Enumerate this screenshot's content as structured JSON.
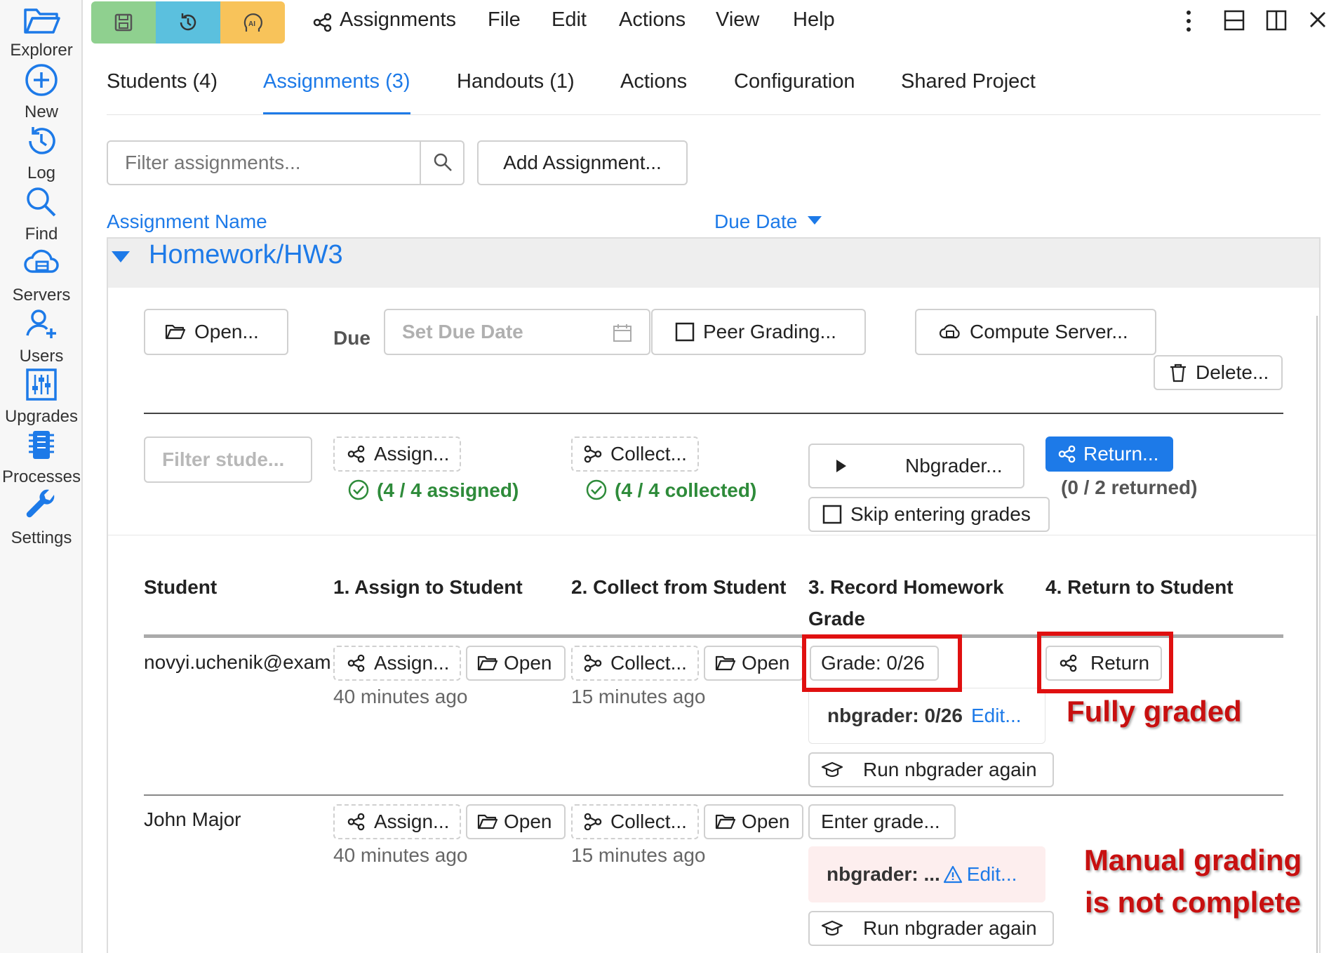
{
  "sidebar": {
    "items": [
      {
        "label": "Explorer",
        "icon": "folder-open-icon"
      },
      {
        "label": "New",
        "icon": "plus-circle-icon"
      },
      {
        "label": "Log",
        "icon": "history-icon"
      },
      {
        "label": "Find",
        "icon": "search-icon"
      },
      {
        "label": "Servers",
        "icon": "cloud-server-icon"
      },
      {
        "label": "Users",
        "icon": "users-icon"
      },
      {
        "label": "Upgrades",
        "icon": "sliders-icon"
      },
      {
        "label": "Processes",
        "icon": "chip-icon"
      },
      {
        "label": "Settings",
        "icon": "wrench-icon"
      }
    ]
  },
  "topbar": {
    "title": "Assignments",
    "menu": [
      "File",
      "Edit",
      "Actions",
      "View",
      "Help"
    ],
    "colors": {
      "save": "#8fd08f",
      "history": "#5bc0de",
      "ai": "#f8c35a"
    }
  },
  "tabs": [
    {
      "label": "Students (4)",
      "active": false
    },
    {
      "label": "Assignments (3)",
      "active": true
    },
    {
      "label": "Handouts (1)",
      "active": false
    },
    {
      "label": "Actions",
      "active": false
    },
    {
      "label": "Configuration",
      "active": false
    },
    {
      "label": "Shared Project",
      "active": false
    }
  ],
  "toolbar": {
    "filter_placeholder": "Filter assignments...",
    "add_label": "Add Assignment..."
  },
  "columns": {
    "name": "Assignment Name",
    "due": "Due Date"
  },
  "assignment": {
    "name": "Homework/HW3",
    "open_label": "Open...",
    "due_label": "Due",
    "due_placeholder": "Set Due Date",
    "peer_label": "Peer Grading...",
    "compute_label": "Compute Server...",
    "delete_label": "Delete...",
    "filter_students_placeholder": "Filter stude...",
    "assign_all_label": "Assign...",
    "assigned_status": "(4 / 4 assigned)",
    "collect_all_label": "Collect...",
    "collected_status": "(4 / 4 collected)",
    "nbgrader_label": "Nbgrader...",
    "skip_label": "Skip entering grades",
    "return_all_label": "Return...",
    "returned_status": "(0 / 2 returned)"
  },
  "student_table": {
    "headers": [
      "Student",
      "1. Assign to Student",
      "2. Collect from Student",
      "3. Record Homework",
      "Grade",
      "4. Return to Student"
    ],
    "rows": [
      {
        "student": "novyi.uchenik@exam",
        "assign_label": "Assign...",
        "open_label": "Open",
        "assign_time": "40 minutes ago",
        "collect_label": "Collect...",
        "collect_open_label": "Open",
        "collect_time": "15 minutes ago",
        "grade_label": "Grade: 0/26",
        "nbgrader_prefix": "nbgrader: 0/26",
        "edit_label": "Edit...",
        "run_again_label": "Run nbgrader again",
        "return_label": "Return"
      },
      {
        "student": "John Major",
        "assign_label": "Assign...",
        "open_label": "Open",
        "assign_time": "40 minutes ago",
        "collect_label": "Collect...",
        "collect_open_label": "Open",
        "collect_time": "15 minutes ago",
        "grade_label": "Enter grade...",
        "nbgrader_prefix": "nbgrader: ...",
        "edit_label": "Edit...",
        "run_again_label": "Run nbgrader again"
      }
    ]
  },
  "annotations": {
    "fully_graded": "Fully graded",
    "manual_line1": "Manual grading",
    "manual_line2": "is not complete",
    "box_color": "#e01010"
  }
}
